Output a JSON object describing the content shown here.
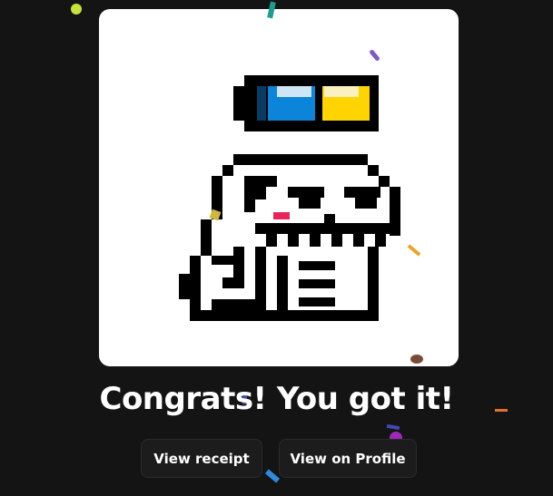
{
  "dialog": {
    "title": "Congrats! You got it!",
    "buttons": {
      "receipt": "View receipt",
      "profile": "View on Profile"
    }
  },
  "nft_image": {
    "subject": "pixel-art skull with battery hat",
    "colors": {
      "battery_blue": "#0B84D9",
      "battery_yellow": "#FFD400",
      "blush": "#E8245A",
      "outline": "#000000"
    }
  },
  "confetti_colors": [
    "#C8E23C",
    "#1A9E8F",
    "#7B5CC7",
    "#D0B93A",
    "#E8A62A",
    "#7A4C35",
    "#E0712B",
    "#9B2AB8",
    "#3F49B8",
    "#2E8BE0"
  ]
}
